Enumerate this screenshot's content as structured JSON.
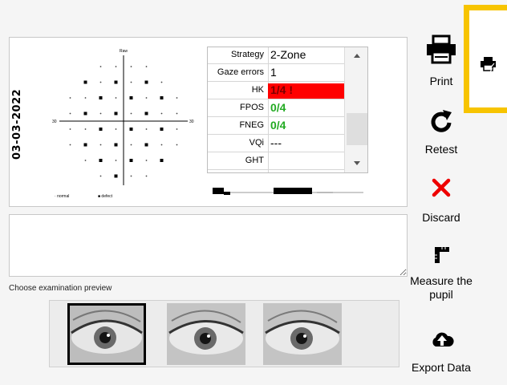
{
  "report": {
    "date": "03-03-2022",
    "plot_title": "Raw",
    "axis_left": "30",
    "axis_right": "30",
    "legend_normal": "normal",
    "legend_defect": "defect"
  },
  "results": {
    "rows": [
      {
        "label": "Strategy",
        "value": "2-Zone",
        "color": "#000000"
      },
      {
        "label": "Gaze errors",
        "value": "1",
        "color": "#000000"
      },
      {
        "label": "HK",
        "value": "1/4 !",
        "color": "#ff0000"
      },
      {
        "label": "FPOS",
        "value": "0/4",
        "color": "#22aa22"
      },
      {
        "label": "FNEG",
        "value": "0/4",
        "color": "#22aa22"
      },
      {
        "label": "VQi",
        "value": "---",
        "color": "#000000"
      },
      {
        "label": "GHT",
        "value": "",
        "color": "#000000"
      }
    ]
  },
  "preview": {
    "label": "Choose examination preview",
    "selected_index": 0,
    "count": 3
  },
  "toolbar": {
    "print": "Print",
    "retest": "Retest",
    "discard": "Discard",
    "measure": "Measure the pupil",
    "export": "Export Data",
    "quick_print_icon": "printer-icon",
    "highlight_color": "#f7c400",
    "discard_color": "#ee0000"
  }
}
